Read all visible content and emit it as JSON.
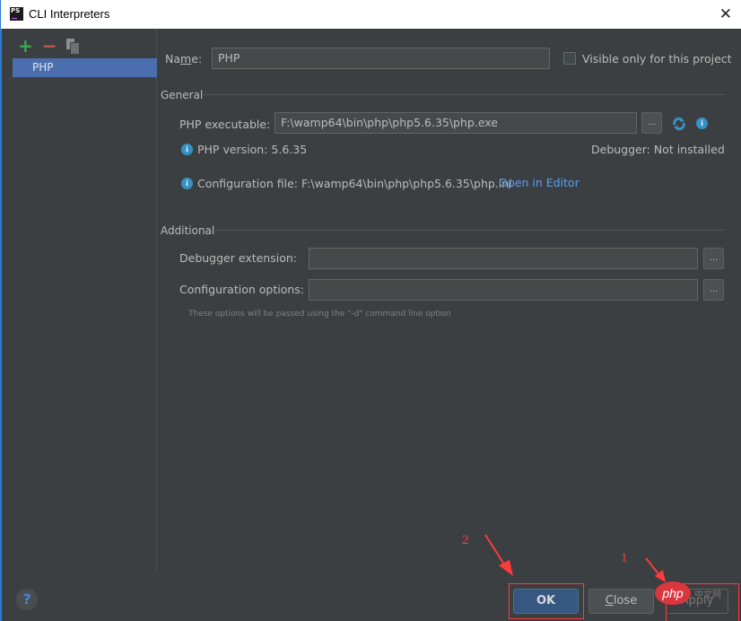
{
  "window": {
    "title": "CLI Interpreters",
    "app_icon_text": "PS",
    "close_glyph": "✕"
  },
  "toolbar": {
    "add_glyph": "+",
    "remove_glyph": "−"
  },
  "interpreters": [
    {
      "label": "PHP",
      "selected": true
    }
  ],
  "form": {
    "name_label": "Name:",
    "name_value": "PHP",
    "visible_only_label": "Visible only for this project",
    "visible_only_checked": false,
    "general_section": "General",
    "php_exe_label": "PHP executable:",
    "php_exe_value": "F:\\wamp64\\bin\\php\\php5.6.35\\php.exe",
    "browse_label": "...",
    "php_version_text": "PHP version: 5.6.35",
    "debugger_text": "Debugger: Not installed",
    "config_file_text": "Configuration file: F:\\wamp64\\bin\\php\\php5.6.35\\php.ini",
    "open_in_editor": "Open in Editor",
    "additional_section": "Additional",
    "debugger_ext_label": "Debugger extension:",
    "debugger_ext_value": "",
    "config_options_label": "Configuration options:",
    "config_options_value": "",
    "hint": "These options will be passed using the \"-d\" command line option"
  },
  "buttons": {
    "ok": "OK",
    "close": "Close",
    "apply": "Apply",
    "help": "?"
  },
  "annotations": {
    "num1": "1",
    "num2": "2",
    "color": "#ff3b3b"
  },
  "watermark": {
    "text": "php",
    "subtext": "中文网"
  }
}
